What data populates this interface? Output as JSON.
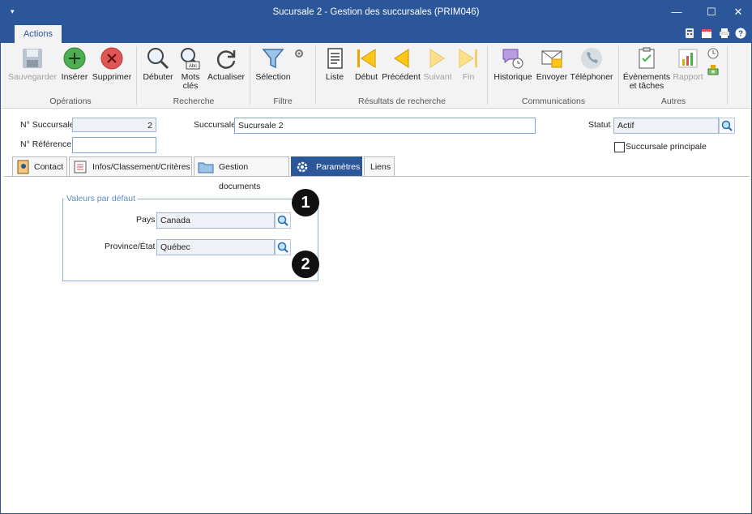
{
  "window": {
    "title": "Sucursale 2 - Gestion des succursales (PRIM046)",
    "minimize": "—",
    "maximize": "☐",
    "close": "✕"
  },
  "ribbon": {
    "tab": "Actions",
    "groups": {
      "operations": "Opérations",
      "recherche": "Recherche",
      "filtre": "Filtre",
      "resultats": "Résultats de recherche",
      "communications": "Communications",
      "autres": "Autres"
    },
    "buttons": {
      "sauvegarder": "Sauvegarder",
      "inserer": "Insérer",
      "supprimer": "Supprimer",
      "debuter": "Débuter",
      "mots_cles_1": "Mots",
      "mots_cles_2": "clés",
      "actualiser": "Actualiser",
      "selection": "Sélection",
      "liste": "Liste",
      "debut": "Début",
      "precedent": "Précédent",
      "suivant": "Suivant",
      "fin": "Fin",
      "historique": "Historique",
      "envoyer": "Envoyer",
      "telephoner": "Téléphoner",
      "evenements_1": "Évènements",
      "evenements_2": "et tâches",
      "rapport": "Rapport"
    }
  },
  "form": {
    "no_succursale_label": "N° Succursale",
    "no_succursale_value": "2",
    "succursale_label": "Succursale",
    "succursale_value": "Sucursale 2",
    "statut_label": "Statut",
    "statut_value": "Actif",
    "no_reference_label": "N° Référence",
    "no_reference_value": "",
    "principale_label": "Succursale principale"
  },
  "tabs": [
    "Contact",
    "Infos/Classement/Critères",
    "Gestion documents",
    "Paramètres",
    "Liens"
  ],
  "parametres": {
    "legend": "Valeurs par défaut",
    "pays_label": "Pays",
    "pays_value": "Canada",
    "province_label": "Province/État",
    "province_value": "Québec"
  },
  "callouts": [
    "1",
    "2"
  ]
}
